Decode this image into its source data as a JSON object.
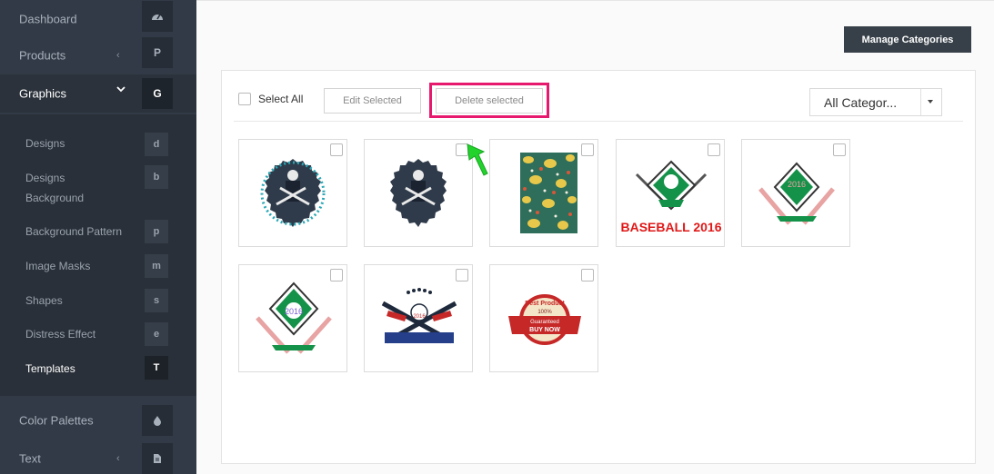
{
  "sidebar": {
    "top_items": [
      {
        "label": "Dashboard",
        "icon": "speedometer-icon",
        "glyph": ""
      },
      {
        "label": "Products",
        "icon": "p-icon",
        "glyph": "P",
        "chevron": "‹"
      },
      {
        "label": "Graphics",
        "icon": "g-icon",
        "glyph": "G",
        "chevron": "⌄"
      }
    ],
    "sub_items": [
      {
        "label": "Designs",
        "glyph": "d"
      },
      {
        "label": "Designs Background",
        "glyph": "b"
      },
      {
        "label": "Background Pattern",
        "glyph": "p"
      },
      {
        "label": "Image Masks",
        "glyph": "m"
      },
      {
        "label": "Shapes",
        "glyph": "s"
      },
      {
        "label": "Distress Effect",
        "glyph": "e"
      },
      {
        "label": "Templates",
        "glyph": "T"
      }
    ],
    "bottom_items": [
      {
        "label": "Color Palettes",
        "icon": "droplet-icon"
      },
      {
        "label": "Text",
        "icon": "document-icon",
        "chevron": "‹"
      }
    ]
  },
  "header": {
    "manage_label": "Manage Categories"
  },
  "toolbar": {
    "select_all_label": "Select All",
    "edit_label": "Edit Selected",
    "delete_label": "Delete selected",
    "category_value": "All Categor..."
  },
  "templates": [
    {
      "kind": "badge-text",
      "texts": []
    },
    {
      "kind": "badge-plain",
      "texts": []
    },
    {
      "kind": "paisley",
      "texts": []
    },
    {
      "kind": "baseball-2016",
      "texts": [
        "BASEBALL 2016"
      ]
    },
    {
      "kind": "diamond-bats",
      "texts": [
        "2016"
      ]
    },
    {
      "kind": "diamond-bats-2",
      "texts": [
        "2016"
      ]
    },
    {
      "kind": "stars-bats",
      "texts": [
        "2016"
      ]
    },
    {
      "kind": "best-product",
      "texts": [
        "Best Product",
        "100%",
        "Guaranteed",
        "BUY NOW"
      ]
    }
  ],
  "colors": {
    "highlight": "#e6196e",
    "arrow": "#22d32c",
    "sidebar": "#313a46"
  }
}
